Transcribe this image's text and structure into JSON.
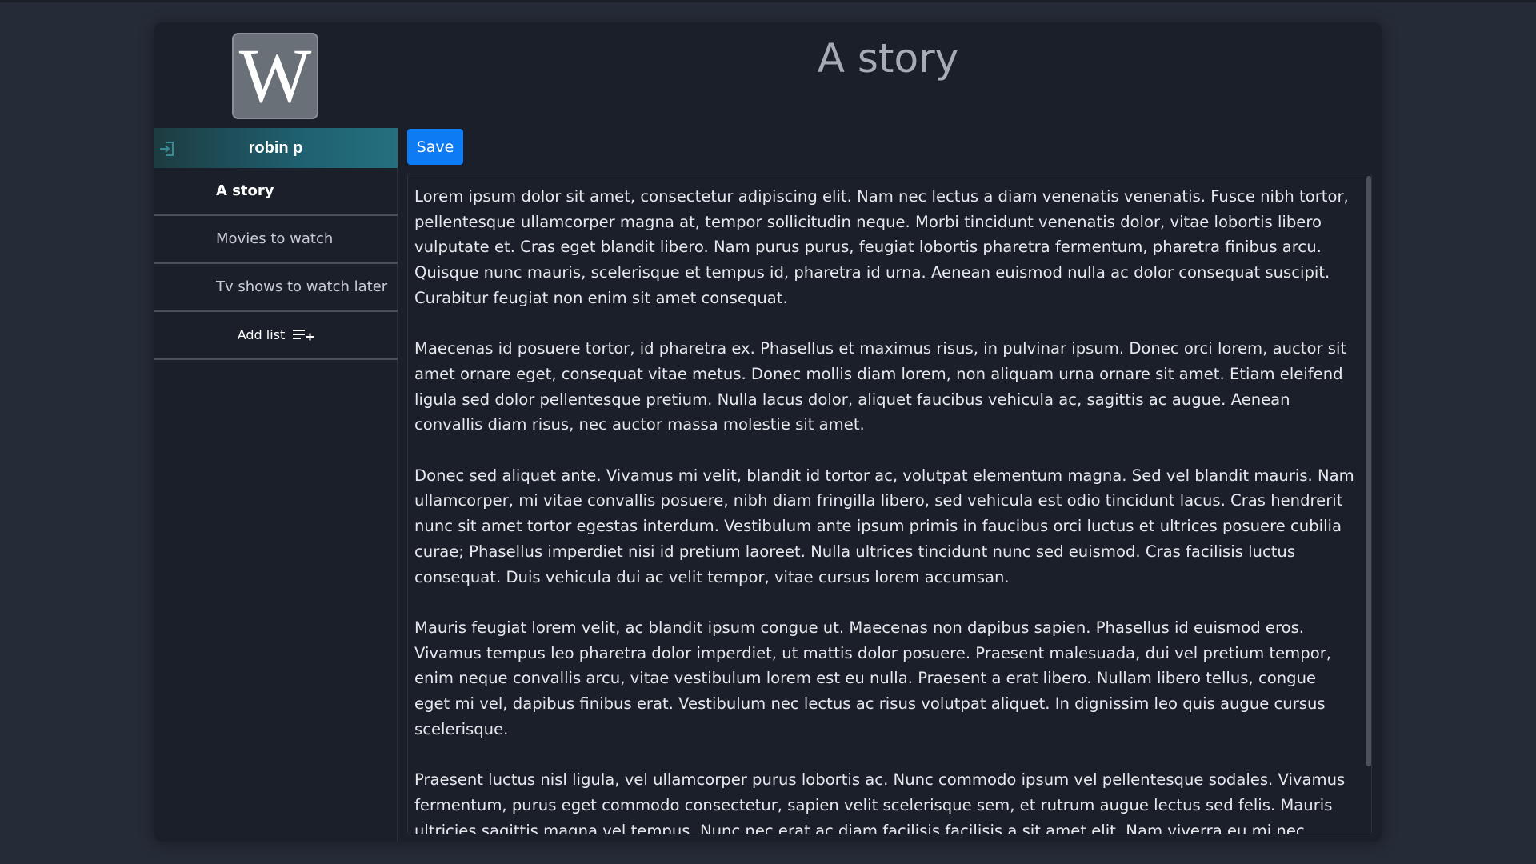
{
  "app": {
    "logo_letter": "W",
    "page_title": "A story",
    "accent_color": "#0d7bf3"
  },
  "user": {
    "name": "robin p",
    "logout_icon": "logout-icon"
  },
  "sidebar": {
    "items": [
      {
        "label": "A story",
        "active": true
      },
      {
        "label": "Movies to watch",
        "active": false
      },
      {
        "label": "Tv shows to watch later",
        "active": false
      }
    ],
    "add_list_label": "Add list",
    "add_list_icon": "playlist-add-icon"
  },
  "toolbar": {
    "save_label": "Save"
  },
  "editor": {
    "paragraphs": [
      "Lorem ipsum dolor sit amet, consectetur adipiscing elit. Nam nec lectus a diam venenatis venenatis. Fusce nibh tortor, pellentesque ullamcorper magna at, tempor sollicitudin neque. Morbi tincidunt venenatis dolor, vitae lobortis libero vulputate et. Cras eget blandit libero. Nam purus purus, feugiat lobortis pharetra fermentum, pharetra finibus arcu. Quisque nunc mauris, scelerisque et tempus id, pharetra id urna. Aenean euismod nulla ac dolor consequat suscipit. Curabitur feugiat non enim sit amet consequat.",
      "Maecenas id posuere tortor, id pharetra ex. Phasellus et maximus risus, in pulvinar ipsum. Donec orci lorem, auctor sit amet ornare eget, consequat vitae metus. Donec mollis diam lorem, non aliquam urna ornare sit amet. Etiam eleifend ligula sed dolor pellentesque pretium. Nulla lacus dolor, aliquet faucibus vehicula ac, sagittis ac augue. Aenean convallis diam risus, nec auctor massa molestie sit amet.",
      "Donec sed aliquet ante. Vivamus mi velit, blandit id tortor ac, volutpat elementum magna. Sed vel blandit mauris. Nam ullamcorper, mi vitae convallis posuere, nibh diam fringilla libero, sed vehicula est odio tincidunt lacus. Cras hendrerit nunc sit amet tortor egestas interdum. Vestibulum ante ipsum primis in faucibus orci luctus et ultrices posuere cubilia curae; Phasellus imperdiet nisi id pretium laoreet. Nulla ultrices tincidunt nunc sed euismod. Cras facilisis luctus consequat. Duis vehicula dui ac velit tempor, vitae cursus lorem accumsan.",
      "Mauris feugiat lorem velit, ac blandit ipsum congue ut. Maecenas non dapibus sapien. Phasellus id euismod eros. Vivamus tempus leo pharetra dolor imperdiet, ut mattis dolor posuere. Praesent malesuada, dui vel pretium tempor, enim neque convallis arcu, vitae vestibulum lorem est eu nulla. Praesent a erat libero. Nullam libero tellus, congue eget mi vel, dapibus finibus erat. Vestibulum nec lectus ac risus volutpat aliquet. In dignissim leo quis augue cursus scelerisque.",
      "Praesent luctus nisl ligula, vel ullamcorper purus lobortis ac. Nunc commodo ipsum vel pellentesque sodales. Vivamus fermentum, purus eget commodo consectetur, sapien velit scelerisque sem, et rutrum augue lectus sed felis. Mauris ultricies sagittis magna vel tempus. Nunc nec erat ac diam facilisis facilisis a sit amet elit. Nam viverra eu mi nec eleifend. Mauris sagittis"
    ]
  }
}
